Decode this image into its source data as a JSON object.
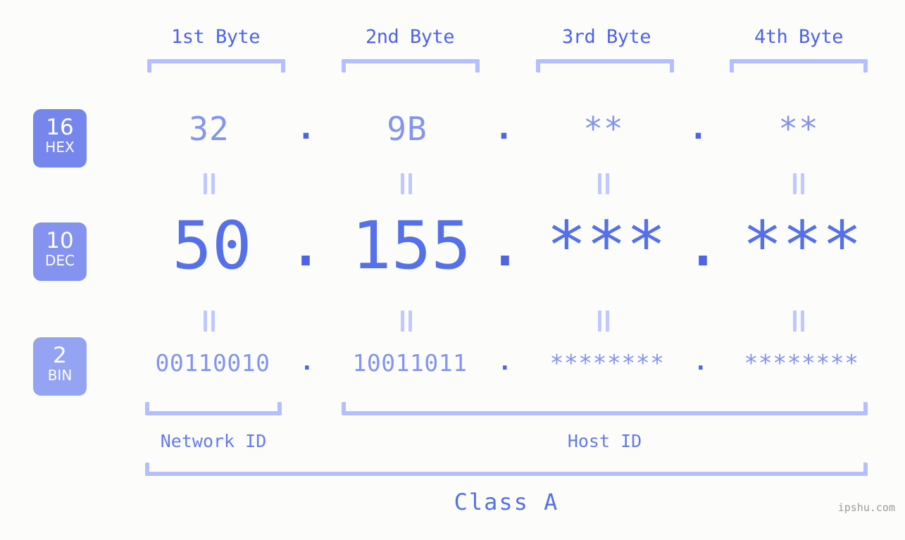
{
  "background_color": "#fcfdfa",
  "accent_colors": {
    "bracket": "#b5beff",
    "header_text": "#4e63e8",
    "hex_text": "#8494f0",
    "dec_text": "#5670ea",
    "bin_text": "#8494f0",
    "dot": "#4e63e8",
    "badge_hex": "#7586ed",
    "badge_dec": "#8493f0",
    "badge_bin": "#95a3f3",
    "equals": "#c0c8ff",
    "watermark": "#9b9b9b"
  },
  "byte_headers": [
    {
      "label": "1st Byte"
    },
    {
      "label": "2nd Byte"
    },
    {
      "label": "3rd Byte"
    },
    {
      "label": "4th Byte"
    }
  ],
  "radix_badges": [
    {
      "number": "16",
      "name": "HEX"
    },
    {
      "number": "10",
      "name": "DEC"
    },
    {
      "number": "2",
      "name": "BIN"
    }
  ],
  "rows": {
    "hex": {
      "radix": "16",
      "radix_name": "HEX",
      "octets": [
        "32",
        "9B",
        "**",
        "**"
      ],
      "separator": "."
    },
    "dec": {
      "radix": "10",
      "radix_name": "DEC",
      "octets": [
        "50",
        "155",
        "***",
        "***"
      ],
      "separator": "."
    },
    "bin": {
      "radix": "2",
      "radix_name": "BIN",
      "octets": [
        "00110010",
        "10011011",
        "********",
        "********"
      ],
      "separator": "."
    }
  },
  "equality_marks": {
    "symbol": "=",
    "count_per_gap": 4,
    "gaps": 2
  },
  "sections": [
    {
      "label": "Network ID"
    },
    {
      "label": "Host ID"
    }
  ],
  "class_label": "Class A",
  "watermark": "ipshu.com"
}
